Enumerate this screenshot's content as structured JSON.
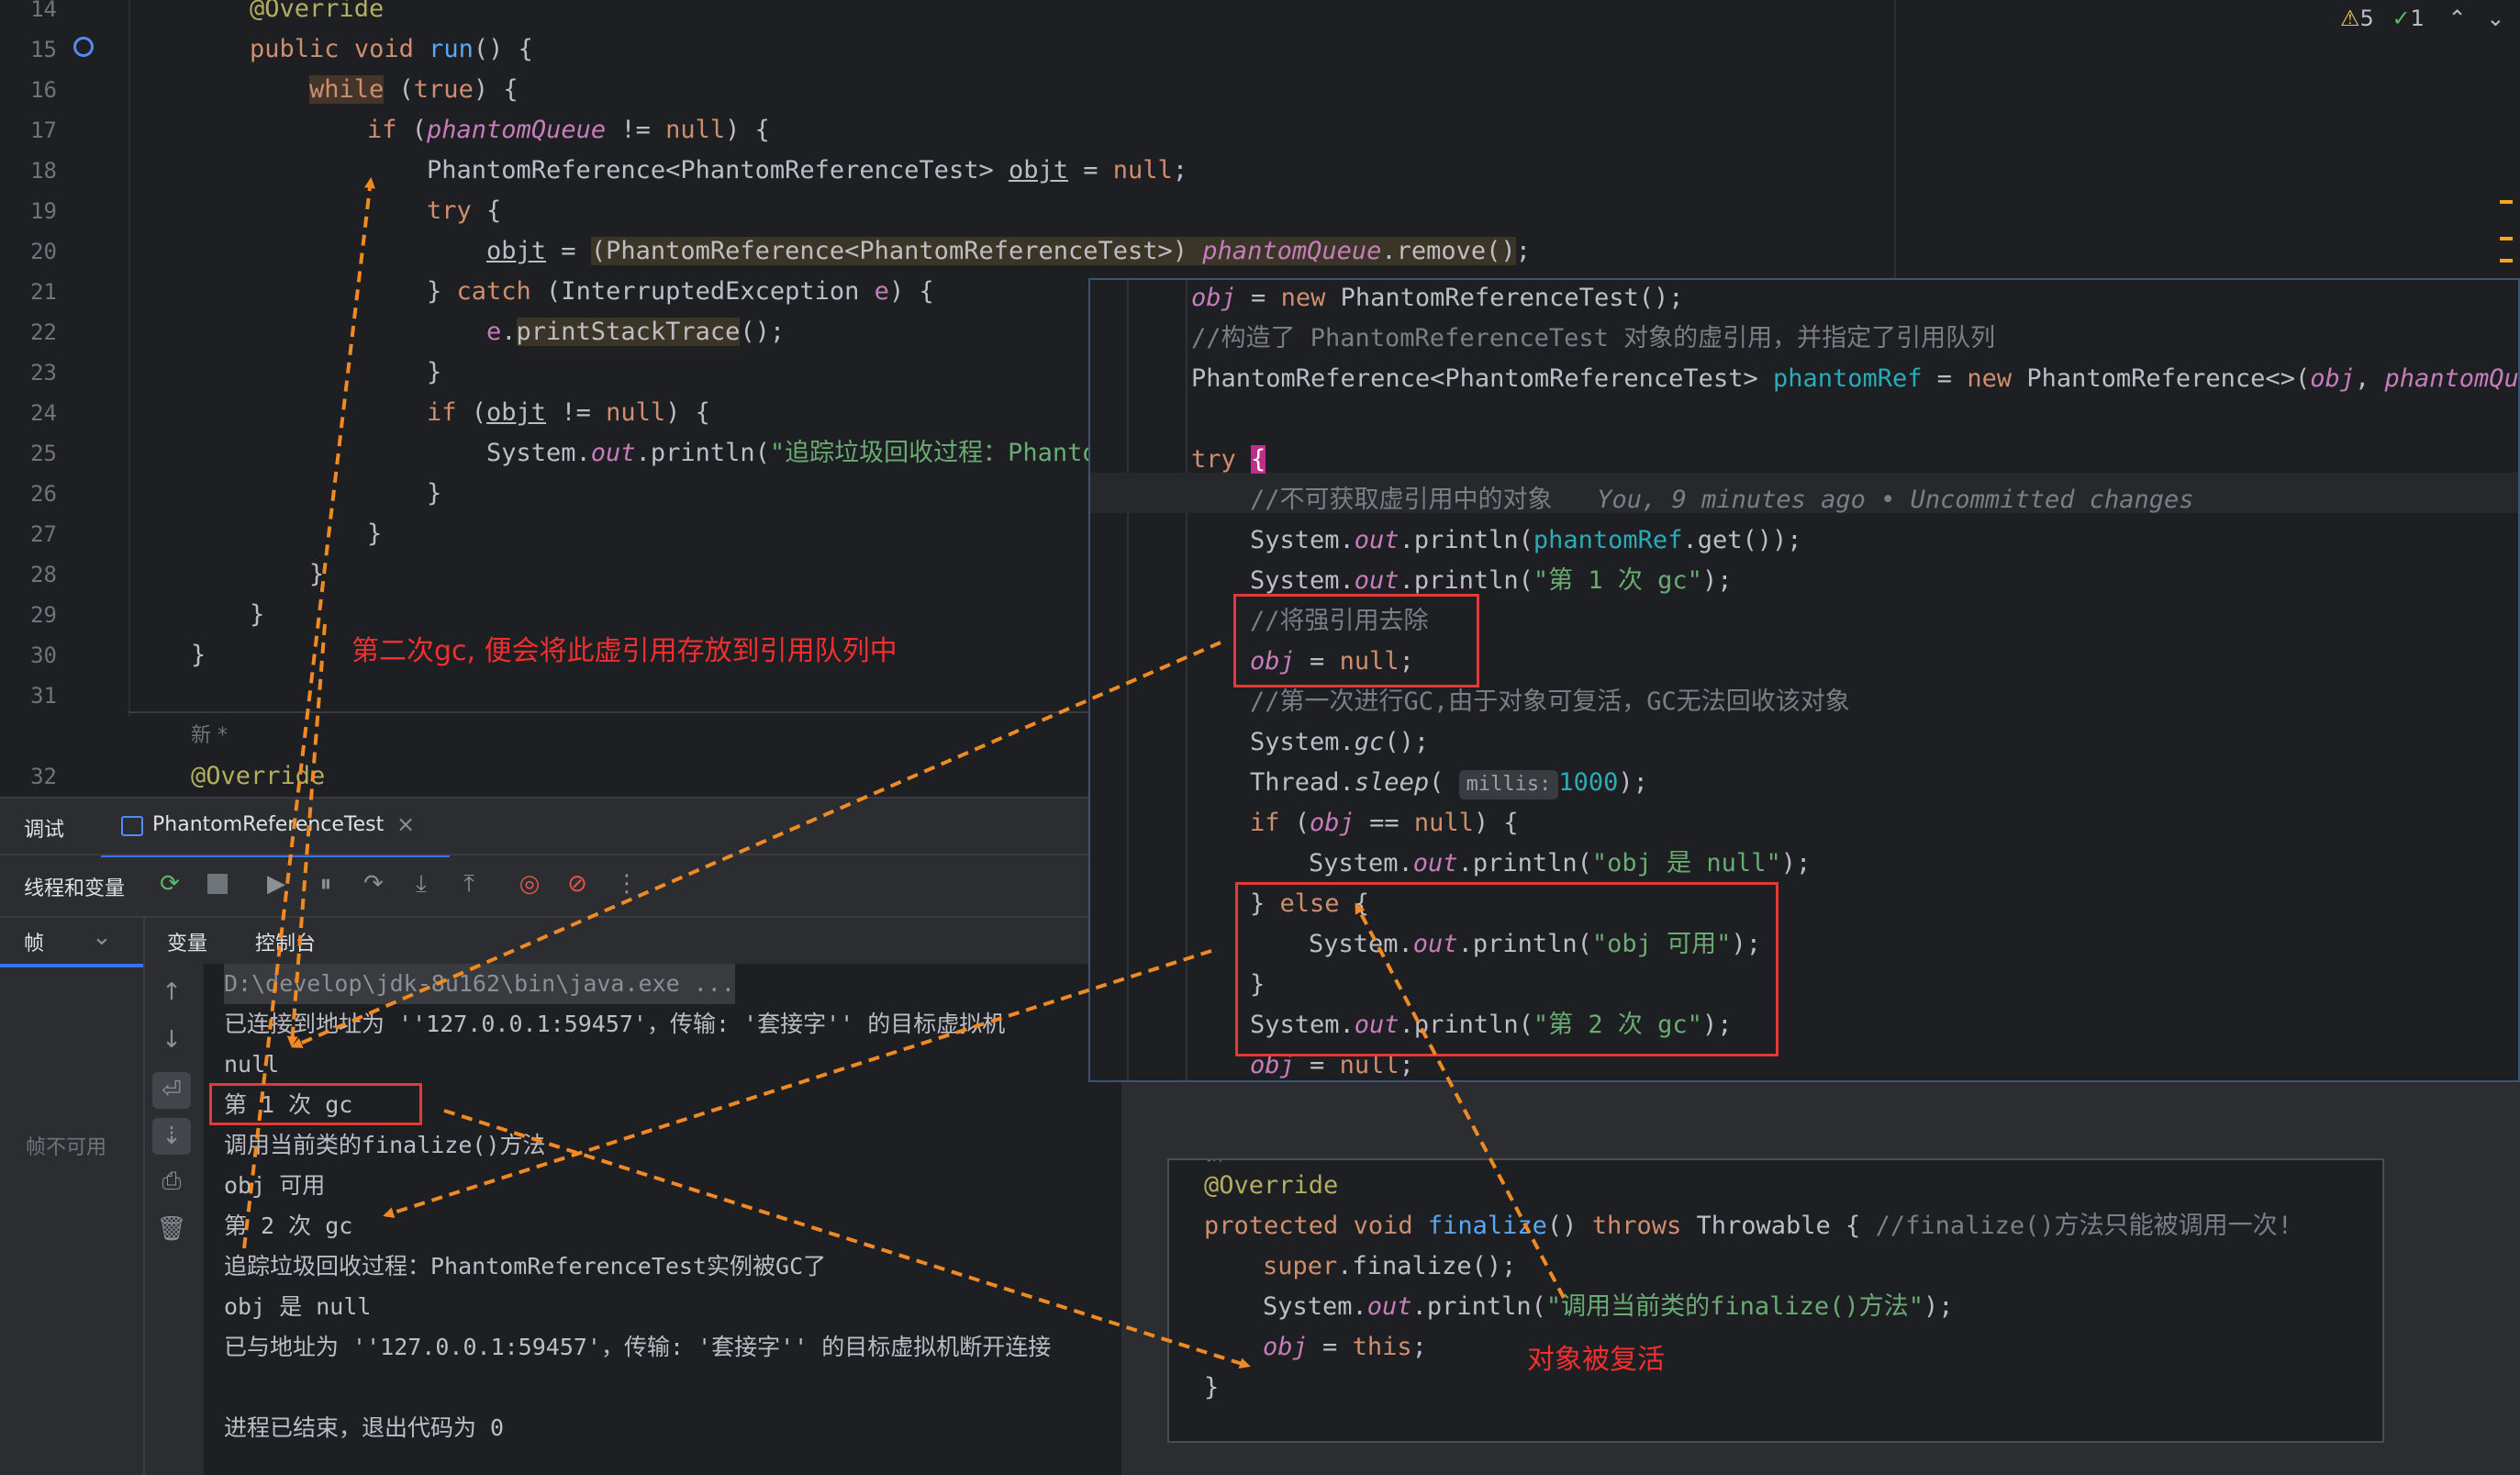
{
  "editor": {
    "lines": [
      {
        "no": "14",
        "text": "@Override"
      },
      {
        "no": "15",
        "text": "public void run() {"
      },
      {
        "no": "16",
        "text": "while (true) {"
      },
      {
        "no": "17",
        "text": "if (phantomQueue != null) {"
      },
      {
        "no": "18",
        "text": "PhantomReference<PhantomReferenceTest> objt = null;"
      },
      {
        "no": "19",
        "text": "try {"
      },
      {
        "no": "20",
        "text": "objt = (PhantomReference<PhantomReferenceTest>) phantomQueue.remove();"
      },
      {
        "no": "21",
        "text": "} catch (InterruptedException e) {"
      },
      {
        "no": "22",
        "text": "e.printStackTrace();"
      },
      {
        "no": "23",
        "text": "}"
      },
      {
        "no": "24",
        "text": "if (objt != null) {"
      },
      {
        "no": "25",
        "text": "System.out.println(\"追踪垃圾回收过程：Phantom"
      },
      {
        "no": "26",
        "text": "}"
      },
      {
        "no": "27",
        "text": "}"
      },
      {
        "no": "28",
        "text": "}"
      },
      {
        "no": "29",
        "text": "}"
      },
      {
        "no": "30",
        "text": "}"
      },
      {
        "no": "31",
        "text": ""
      },
      {
        "no": "32",
        "text": "@Override"
      }
    ],
    "new_marker": "新 *",
    "inspection": {
      "warnings": "5",
      "checks": "1"
    }
  },
  "overlay_main": {
    "lines": [
      "obj = new PhantomReferenceTest();",
      "//构造了 PhantomReferenceTest 对象的虚引用，并指定了引用队列",
      "PhantomReference<PhantomReferenceTest> phantomRef = new PhantomReference<>(obj, phantomQueue",
      "",
      "try {",
      "//不可获取虚引用中的对象",
      "System.out.println(phantomRef.get());",
      "System.out.println(\"第 1 次 gc\");",
      "//将强引用去除",
      "obj = null;",
      "//第一次进行GC,由于对象可复活，GC无法回收该对象",
      "System.gc();",
      "Thread.sleep( millis: 1000);",
      "if (obj == null) {",
      "System.out.println(\"obj 是 null\");",
      "} else {",
      "System.out.println(\"obj 可用\");",
      "}",
      "System.out.println(\"第 2 次 gc\");",
      "obj = null;"
    ],
    "blame": "You, 9 minutes ago • Uncommitted changes",
    "param_hint": "millis:"
  },
  "overlay_finalize": {
    "lines": [
      "@Override",
      "protected void finalize() throws Throwable { //finalize()方法只能被调用一次!",
      "super.finalize();",
      "System.out.println(\"调用当前类的finalize()方法\");",
      "obj = this;",
      "}"
    ],
    "new_marker": "新 *"
  },
  "annotations": {
    "second_gc": "第二次gc, 便会将此虚引用存放到引用队列中",
    "revived": "对象被复活"
  },
  "debug": {
    "tab_debug": "调试",
    "tab_session": "PhantomReferenceTest",
    "threads_vars": "线程和变量",
    "frames": "帧",
    "tab_vars": "变量",
    "tab_console": "控制台",
    "frames_unavailable": "帧不可用",
    "console": [
      "D:\\develop\\jdk-8u162\\bin\\java.exe ...",
      "已连接到地址为 ''127.0.0.1:59457'，传输: '套接字'' 的目标虚拟机",
      "null",
      "第 1 次 gc",
      "调用当前类的finalize()方法",
      "obj 可用",
      "第 2 次 gc",
      "追踪垃圾回收过程：PhantomReferenceTest实例被GC了",
      "obj 是 null",
      "已与地址为 ''127.0.0.1:59457'，传输: '套接字'' 的目标虚拟机断开连接",
      "",
      "进程已结束，退出代码为 0"
    ]
  },
  "colors": {
    "accent": "#f5a623",
    "annotation_red": "#e53935",
    "arrow": "#f08a24"
  }
}
